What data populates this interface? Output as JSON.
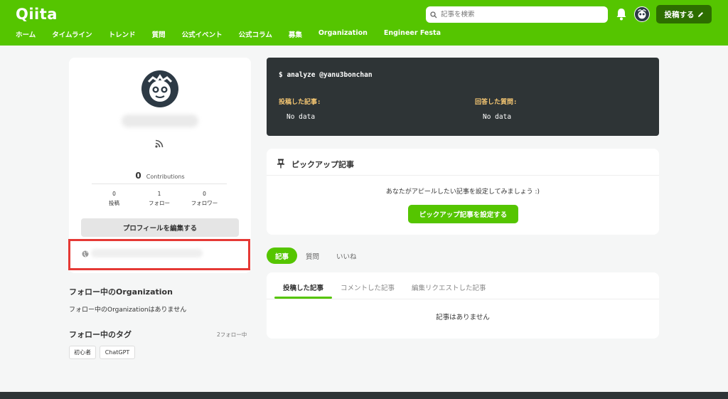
{
  "header": {
    "logo": "Qiita",
    "search_placeholder": "記事を検索",
    "post_button": "投稿する",
    "nav": [
      "ホーム",
      "タイムライン",
      "トレンド",
      "質問",
      "公式イベント",
      "公式コラム",
      "募集",
      "Organization",
      "Engineer Festa"
    ]
  },
  "profile": {
    "contributions_count": "0",
    "contributions_label": "Contributions",
    "stats": [
      {
        "value": "0",
        "label": "投稿"
      },
      {
        "value": "1",
        "label": "フォロー"
      },
      {
        "value": "0",
        "label": "フォロワー"
      }
    ],
    "edit_button": "プロフィールを編集する"
  },
  "organizations": {
    "heading": "フォロー中のOrganization",
    "empty": "フォロー中のOrganizationはありません"
  },
  "tags": {
    "heading": "フォロー中のタグ",
    "count": "2フォロー中",
    "items": [
      "初心者",
      "ChatGPT"
    ]
  },
  "terminal": {
    "command": "$ analyze @yanu3bonchan",
    "posted_label": "投稿した記事:",
    "posted_value": "No data",
    "answered_label": "回答した質問:",
    "answered_value": "No data"
  },
  "pickup": {
    "title": "ピックアップ記事",
    "message": "あなたがアピールしたい記事を設定してみましょう :)",
    "button": "ピックアップ記事を設定する"
  },
  "tabs": [
    "記事",
    "質問",
    "いいね"
  ],
  "article_tabs": [
    "投稿した記事",
    "コメントした記事",
    "編集リクエストした記事"
  ],
  "articles_empty": "記事はありません",
  "colors": {
    "brand": "#55c500",
    "terminal_bg": "#2e3436",
    "highlight": "#e53935"
  }
}
